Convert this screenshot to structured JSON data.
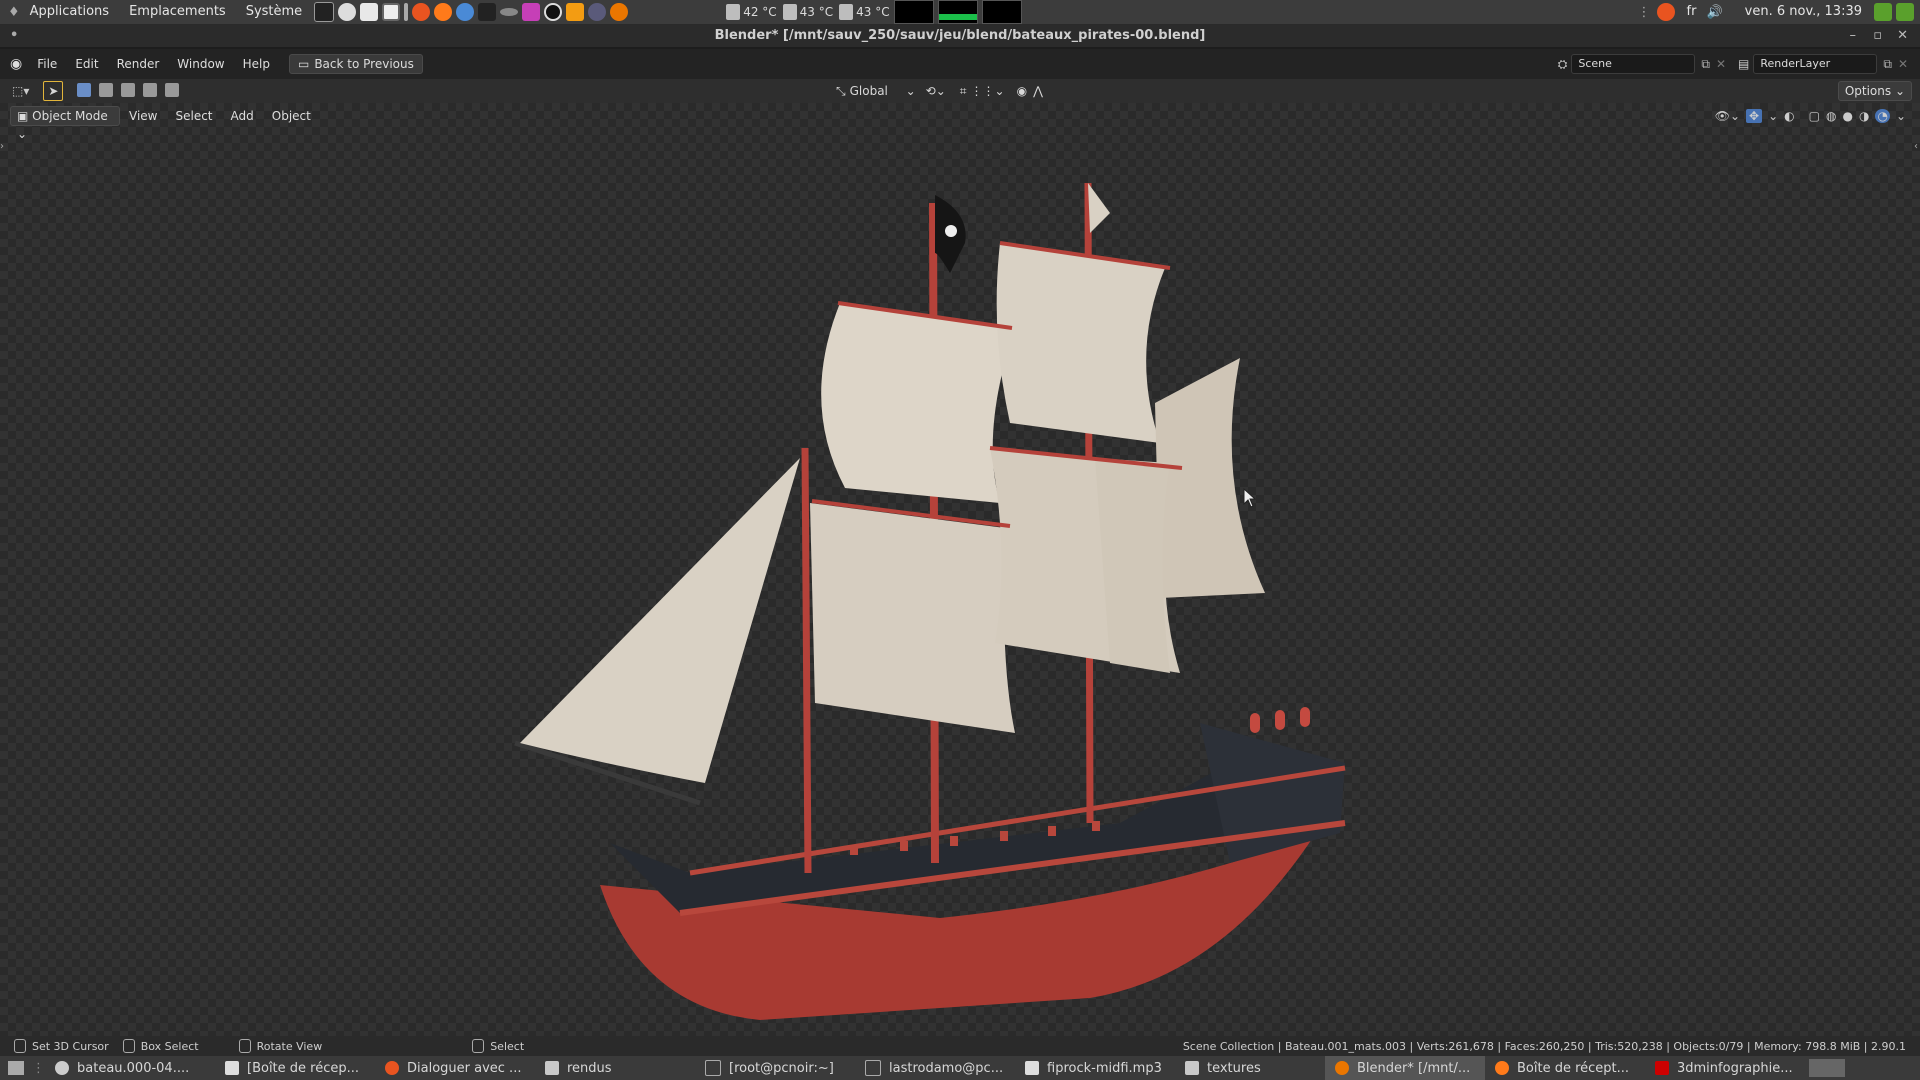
{
  "panel": {
    "menus": [
      "Applications",
      "Emplacements",
      "Système"
    ],
    "temps": [
      "42 °C",
      "43 °C",
      "43 °C"
    ],
    "keyboard": "fr",
    "clock": "ven. 6 nov., 13:39"
  },
  "window": {
    "title": "Blender* [/mnt/sauv_250/sauv/jeu/blend/bateaux_pirates-00.blend]"
  },
  "topbar": {
    "menus": [
      "File",
      "Edit",
      "Render",
      "Window",
      "Help"
    ],
    "back_label": "Back to Previous",
    "scene": "Scene",
    "renderlayer": "RenderLayer"
  },
  "header": {
    "transform_orientation": "Global",
    "options_label": "Options",
    "mode": "Object Mode",
    "menus": [
      "View",
      "Select",
      "Add",
      "Object"
    ]
  },
  "status": {
    "hints": [
      "Set 3D Cursor",
      "Box Select",
      "Rotate View",
      "Select"
    ],
    "stats": "Scene Collection | Bateau.001_mats.003 | Verts:261,678 | Faces:260,250 | Tris:520,238 | Objects:0/79 | Memory: 798.8 MiB | 2.90.1"
  },
  "taskbar": {
    "tasks": [
      "bateau.000-04....",
      "[Boîte de récep...",
      "Dialoguer avec ...",
      "rendus",
      "[root@pcnoir:~]",
      "lastrodamo@pc...",
      "fiprock-midfi.mp3",
      "textures",
      "Blender* [/mnt/...",
      "Boîte de récept...",
      "3dminfographie..."
    ]
  },
  "colors": {
    "accent": "#4772b3",
    "hull": "#a83a32",
    "sail": "#d9d1c4"
  }
}
